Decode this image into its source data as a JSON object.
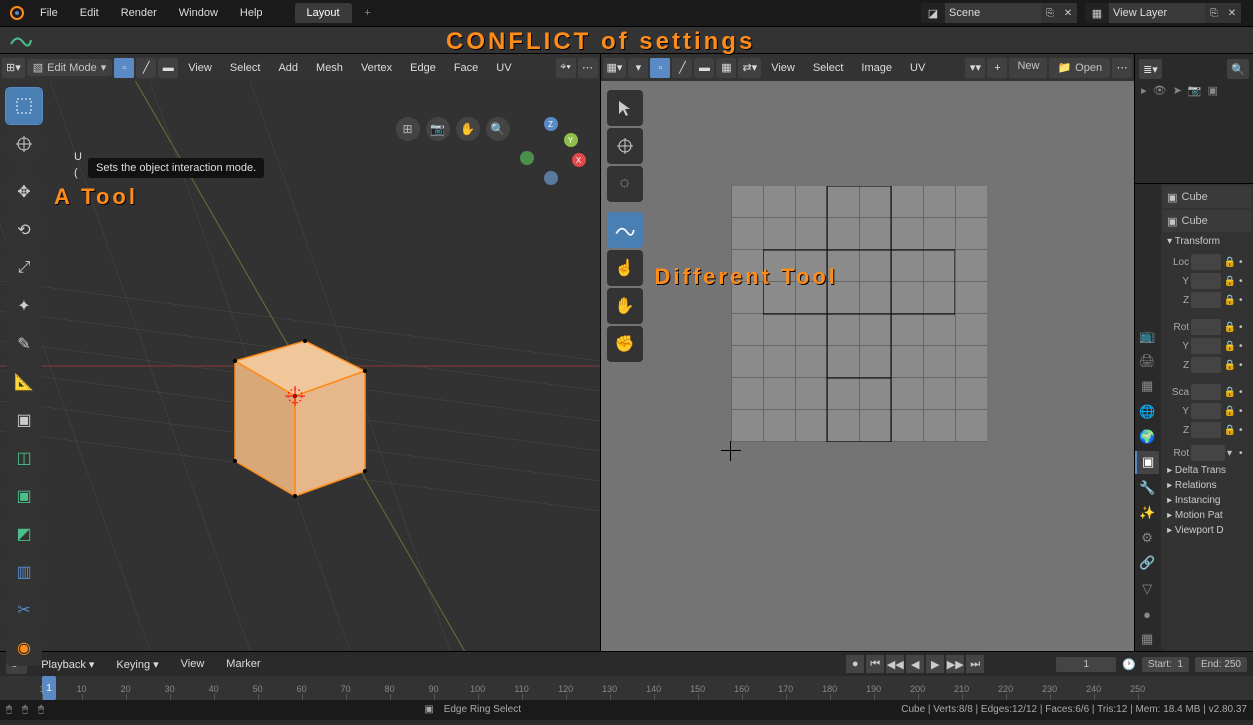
{
  "top_menu": [
    "File",
    "Edit",
    "Render",
    "Window",
    "Help"
  ],
  "workspace_tab": "Layout",
  "scene_field": "Scene",
  "viewlayer_field": "View Layer",
  "annotations": {
    "conflict": "CONFLICT  of  settings",
    "a_tool": "A  Tool",
    "diff_tool": "Different  Tool"
  },
  "tooltip": "Sets the object interaction mode.",
  "viewport3d": {
    "mode": "Edit Mode",
    "header_menus": [
      "View",
      "Select",
      "Add",
      "Mesh",
      "Vertex",
      "Edge",
      "Face",
      "UV"
    ],
    "overlay_label": "U",
    "overlay_sub": "("
  },
  "uv_editor": {
    "header_menus": [
      "View",
      "Select",
      "Image",
      "UV"
    ],
    "new_btn": "New",
    "open_btn": "Open"
  },
  "properties": {
    "object_name": "Cube",
    "panel_title": "Transform",
    "sections": {
      "loc": {
        "label": "Loc",
        "axes": [
          "Y",
          "Z"
        ]
      },
      "rot": {
        "label": "Rot",
        "axes": [
          "Y",
          "Z"
        ]
      },
      "sca": {
        "label": "Sca",
        "axes": [
          "Y",
          "Z"
        ]
      },
      "rot2": "Rot"
    },
    "collapsed": [
      "Delta Trans",
      "Relations",
      "Instancing",
      "Motion Pat",
      "Viewport D"
    ]
  },
  "timeline": {
    "menus": [
      "Playback",
      "Keying",
      "View",
      "Marker"
    ],
    "current": "1",
    "start_lbl": "Start:",
    "start": "1",
    "end_lbl": "End:",
    "end": "250",
    "ticks": [
      1,
      10,
      20,
      30,
      40,
      50,
      60,
      70,
      80,
      90,
      100,
      110,
      120,
      130,
      140,
      150,
      160,
      170,
      180,
      190,
      200,
      210,
      220,
      230,
      240,
      250
    ]
  },
  "statusbar": {
    "context": "Edge Ring Select",
    "stats": "Cube | Verts:8/8 | Edges:12/12 | Faces:6/6 | Tris:12 | Mem: 18.4 MB | v2.80.37"
  }
}
